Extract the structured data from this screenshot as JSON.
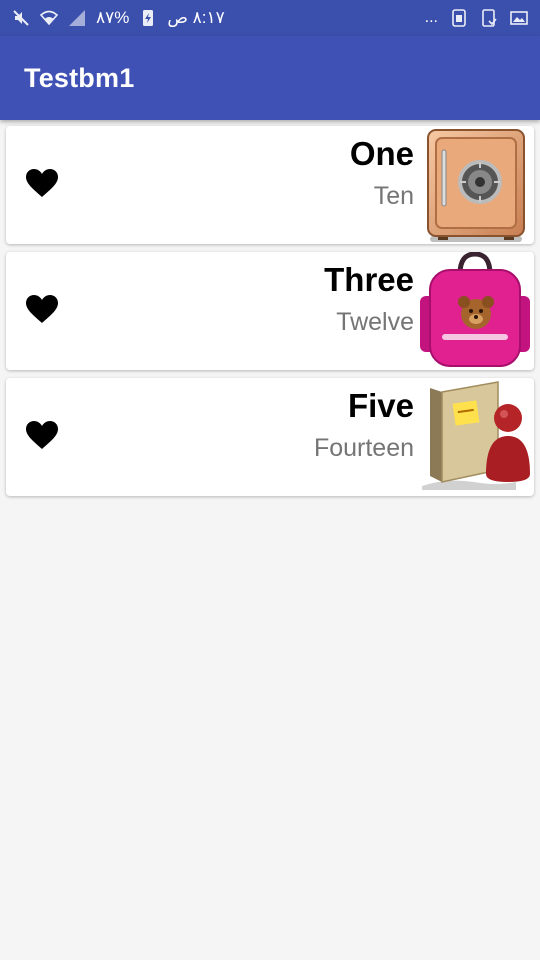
{
  "status_bar": {
    "time": "٨:١٧ ص",
    "battery": "%٨٧",
    "more": "..."
  },
  "app_bar": {
    "title": "Testbm1"
  },
  "items": [
    {
      "title": "One",
      "subtitle": "Ten",
      "thumbnail": "safe-icon",
      "heart": "heart-icon"
    },
    {
      "title": "Three",
      "subtitle": "Twelve",
      "thumbnail": "backpack-icon",
      "heart": "heart-icon"
    },
    {
      "title": "Five",
      "subtitle": "Fourteen",
      "thumbnail": "user-folder-icon",
      "heart": "heart-icon"
    }
  ],
  "colors": {
    "status_bar": "#3b4fac",
    "app_bar": "#3f51b5",
    "background": "#f5f5f5",
    "subtitle": "#757575"
  }
}
